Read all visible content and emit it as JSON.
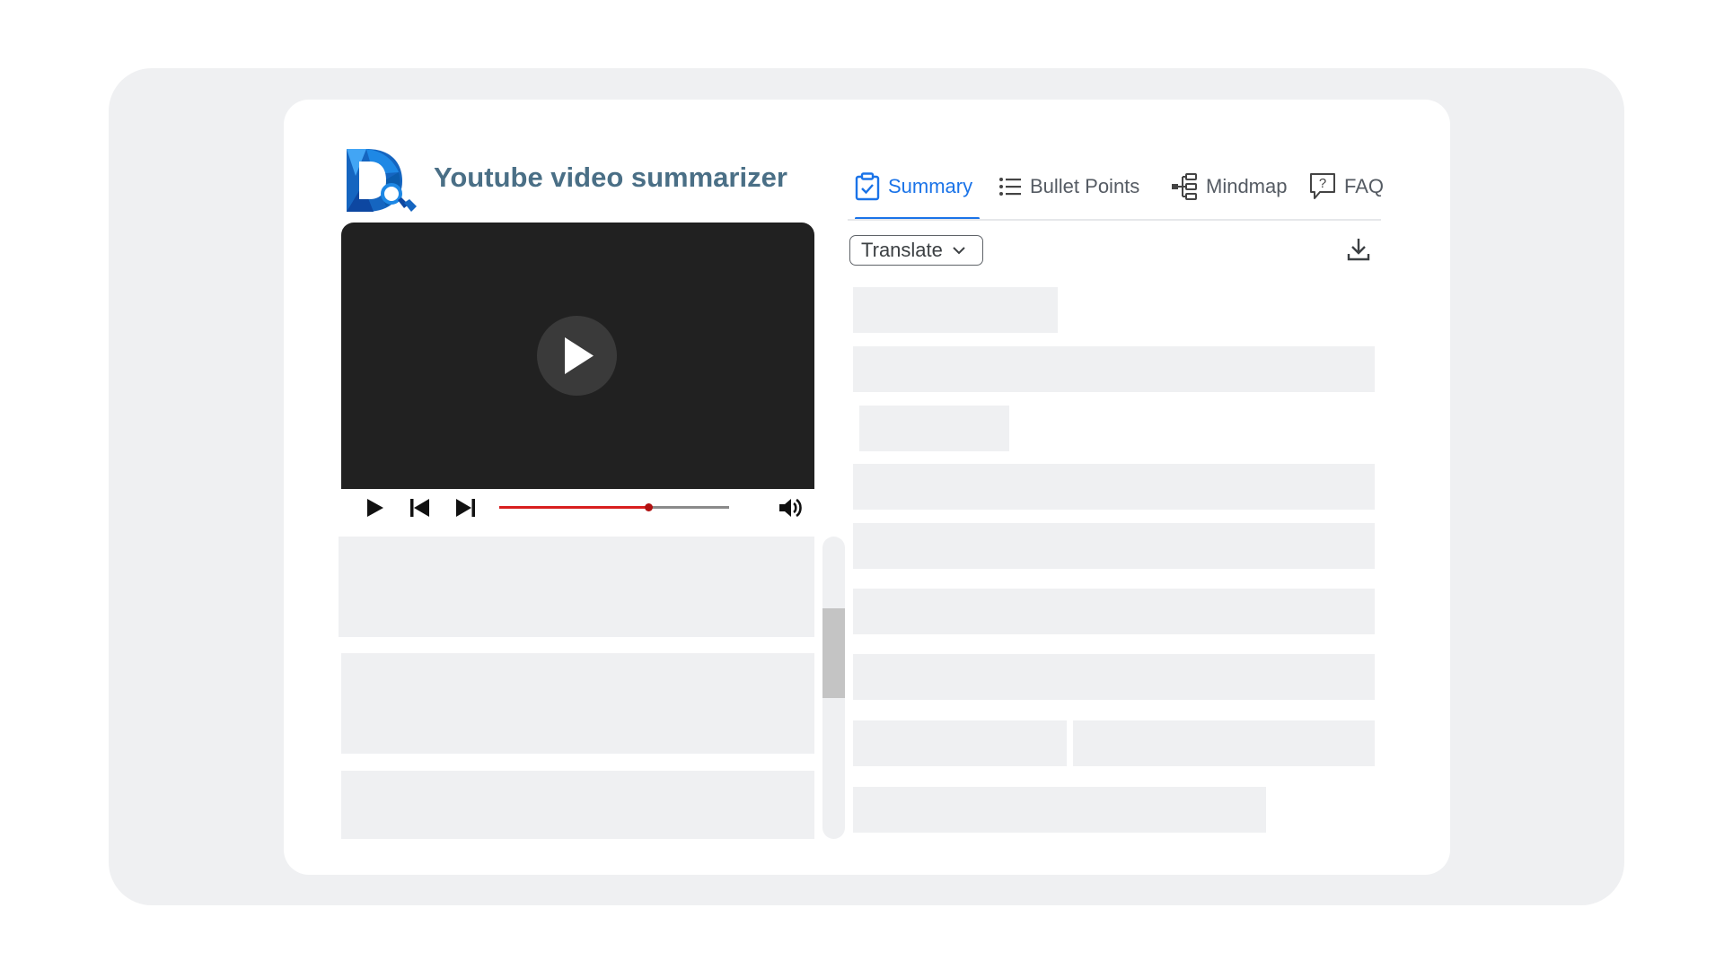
{
  "app": {
    "title": "Youtube video summarizer",
    "logo_icon": "dq-magnifier-logo"
  },
  "player": {
    "big_play_icon": "play-icon",
    "controls": [
      "play-icon",
      "skip-previous-icon",
      "skip-next-icon",
      "volume-icon"
    ],
    "progress_fraction": 0.65,
    "colors": {
      "progress": "#d81f1f",
      "knob": "#b01010",
      "screen": "#212121"
    }
  },
  "tabs": [
    {
      "label": "Summary",
      "icon": "clipboard-check-icon",
      "active": true
    },
    {
      "label": "Bullet Points",
      "icon": "list-icon",
      "active": false
    },
    {
      "label": "Mindmap",
      "icon": "mindmap-icon",
      "active": false
    },
    {
      "label": "FAQ",
      "icon": "question-bubble-icon",
      "active": false
    }
  ],
  "toolbar": {
    "translate_label": "Translate",
    "download_icon": "download-icon"
  },
  "colors": {
    "accent": "#1a73e8",
    "title": "#4a6f86",
    "skeleton": "#eff0f2",
    "background": "#eff0f2"
  }
}
